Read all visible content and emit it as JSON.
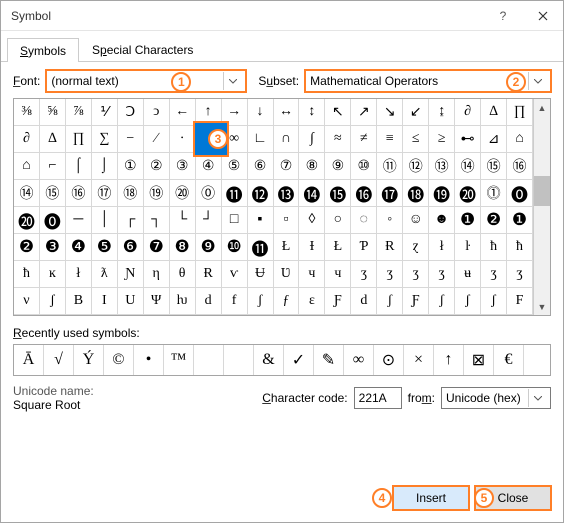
{
  "window": {
    "title": "Symbol"
  },
  "tabs": {
    "symbols": "Symbols",
    "special": "Special Characters"
  },
  "font": {
    "label": "Font:",
    "value": "(normal text)"
  },
  "subset": {
    "label": "Subset:",
    "value": "Mathematical Operators"
  },
  "grid": {
    "rows": [
      [
        "⅜",
        "⅝",
        "⅞",
        "⅟",
        "Ↄ",
        "ↄ",
        "←",
        "↑",
        "→",
        "↓",
        "↔",
        "↕",
        "↖",
        "↗",
        "↘",
        "↙",
        "↨",
        "∂",
        "∆",
        "∏"
      ],
      [
        "∂",
        "∆",
        "∏",
        "∑",
        "−",
        "∕",
        "∙",
        "√",
        "∞",
        "∟",
        "∩",
        "∫",
        "≈",
        "≠",
        "≡",
        "≤",
        "≥",
        "⊷",
        "⊿",
        "⌂"
      ],
      [
        "⌂",
        "⌐",
        "⌠",
        "⌡",
        "①",
        "②",
        "③",
        "④",
        "⑤",
        "⑥",
        "⑦",
        "⑧",
        "⑨",
        "⑩",
        "⑪",
        "⑫",
        "⑬",
        "⑭",
        "⑮",
        "⑯"
      ],
      [
        "⑭",
        "⑮",
        "⑯",
        "⑰",
        "⑱",
        "⑲",
        "⑳",
        "⓪",
        "⓫",
        "⓬",
        "⓭",
        "⓮",
        "⓯",
        "⓰",
        "⓱",
        "⓲",
        "⓳",
        "⓴",
        "⓵",
        "⓿"
      ],
      [
        "⓴",
        "⓿",
        "─",
        "│",
        "┌",
        "┐",
        "└",
        "┘",
        "□",
        "▪",
        "▫",
        "◊",
        "○",
        "◌",
        "◦",
        "☺",
        "☻",
        "❶",
        "❷",
        "❶"
      ],
      [
        "❷",
        "❸",
        "❹",
        "❺",
        "❻",
        "❼",
        "❽",
        "❾",
        "❿",
        "⓫",
        "Ł",
        "Ɨ",
        "Ł",
        "Ƥ",
        "Ɍ",
        "ɀ",
        "ł",
        "ŀ",
        "ħ",
        "ħ"
      ],
      [
        "ħ",
        "ĸ",
        "ł",
        "ƛ",
        "Ɲ",
        "η",
        "θ",
        "Ɍ",
        "ѵ",
        "Ʉ",
        "Ʋ",
        "ч",
        "ч",
        "ʒ",
        "ʒ",
        "ʒ",
        "ʒ",
        "ʉ",
        "ʒ",
        "ʒ"
      ],
      [
        "ν",
        "ʃ",
        "B",
        "I",
        "U",
        "Ψ",
        "ƕ",
        "d",
        "f",
        "ʃ",
        "ƒ",
        "ɛ",
        "Ƒ",
        "d",
        "ʃ",
        "Ƒ",
        "ʃ",
        "ʃ",
        "ʃ",
        "F"
      ]
    ],
    "selected_symbol": "√"
  },
  "recent": {
    "label": "Recently used symbols:",
    "items": [
      "Ā",
      "√",
      "Ý",
      "©",
      "•",
      "™",
      "",
      "",
      "&",
      "✓",
      "✎",
      "∞",
      "⊙",
      "×",
      "↑",
      "⊠",
      "€"
    ]
  },
  "unicode": {
    "label": "Unicode name:",
    "name": "Square Root"
  },
  "code": {
    "label": "Character code:",
    "value": "221A"
  },
  "from": {
    "label": "from:",
    "value": "Unicode (hex)"
  },
  "buttons": {
    "insert": "Insert",
    "close": "Close"
  },
  "badges": {
    "b1": "1",
    "b2": "2",
    "b3": "3",
    "b4": "4",
    "b5": "5"
  }
}
